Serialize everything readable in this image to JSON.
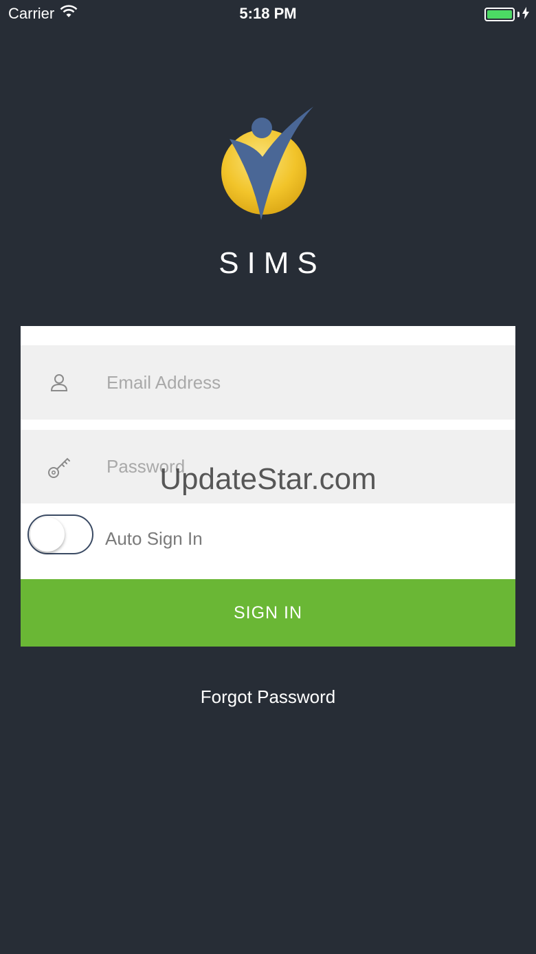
{
  "status_bar": {
    "carrier": "Carrier",
    "time": "5:18 PM",
    "battery_color": "#4cd964"
  },
  "app": {
    "title": "SIMS",
    "logo_colors": {
      "circle": "#f2c42a",
      "figure": "#4a6796"
    }
  },
  "form": {
    "email_placeholder": "Email Address",
    "email_value": "",
    "email_icon": "user-icon",
    "password_placeholder": "Password",
    "password_value": "",
    "password_icon": "key-icon",
    "auto_sign_in_label": "Auto Sign In",
    "auto_sign_in_on": false,
    "sign_in_label": "SIGN IN",
    "sign_in_color": "#6ab735"
  },
  "forgot_password_label": "Forgot Password",
  "watermark": "UpdateStar.com"
}
